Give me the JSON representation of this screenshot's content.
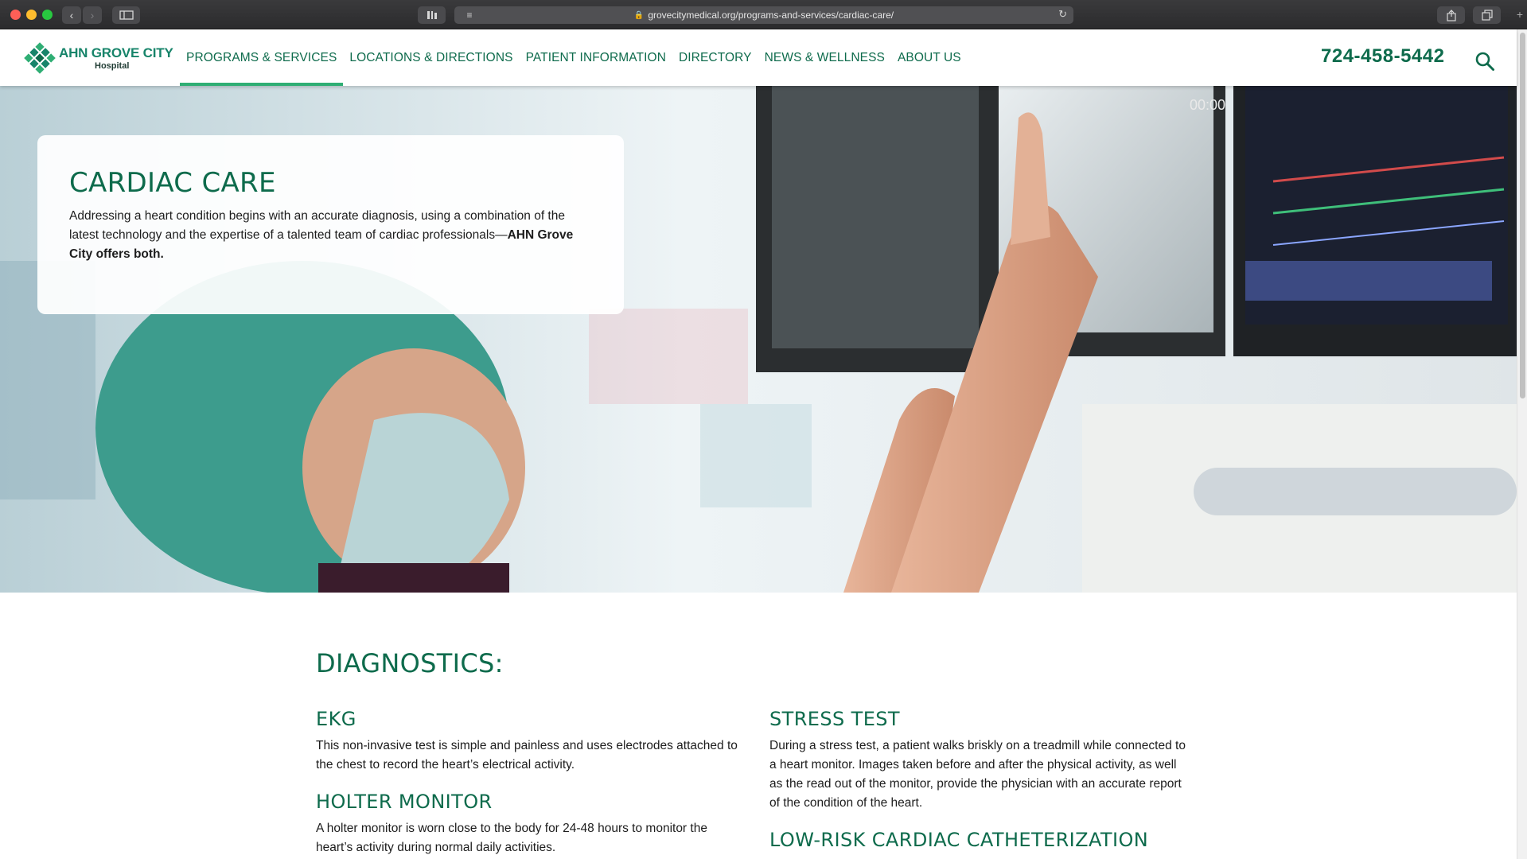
{
  "browser": {
    "url": "grovecitymedical.org/programs-and-services/cardiac-care/"
  },
  "header": {
    "logo_name": "AHN GROVE CITY",
    "logo_sub": "Hospital",
    "nav": [
      {
        "label": "PROGRAMS & SERVICES",
        "active": true
      },
      {
        "label": "LOCATIONS & DIRECTIONS",
        "active": false
      },
      {
        "label": "PATIENT INFORMATION",
        "active": false
      },
      {
        "label": "DIRECTORY",
        "active": false
      },
      {
        "label": "NEWS & WELLNESS",
        "active": false
      },
      {
        "label": "ABOUT US",
        "active": false
      }
    ],
    "phone": "724-458-5442"
  },
  "hero": {
    "title": "CARDIAC CARE",
    "text": "Addressing a heart condition begins with an accurate diagnosis, using a combination of the latest technology and the expertise of a talented team of cardiac professionals—",
    "text_bold": "AHN Grove City offers both."
  },
  "diagnostics": {
    "title": "DIAGNOSTICS:",
    "items": [
      {
        "title": "EKG",
        "text": "This non-invasive test is simple and painless and uses electrodes attached to the chest to record the heart’s electrical activity."
      },
      {
        "title": "HOLTER MONITOR",
        "text": "A holter monitor is worn close to the body for 24-48 hours to monitor the heart’s activity during normal daily activities."
      },
      {
        "title": "STRESS TEST",
        "text": "During a stress test, a patient walks briskly on a treadmill while connected to a heart monitor. Images taken before and after the physical activity, as well as the read out of the monitor, provide the physician with an accurate report of the condition of the heart."
      },
      {
        "title": "LOW-RISK CARDIAC CATHETERIZATION",
        "text": ""
      }
    ]
  },
  "colors": {
    "brand_green": "#0e6b4c",
    "nav_active_underline": "#2fae74",
    "logo_green": "#17846a"
  }
}
